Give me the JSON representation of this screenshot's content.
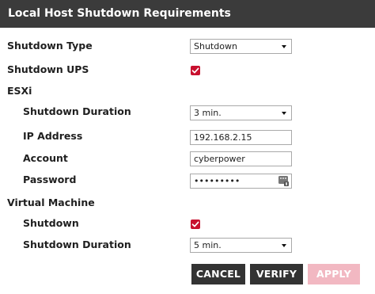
{
  "dialog": {
    "title": "Local Host Shutdown Requirements"
  },
  "shutdown_type": {
    "label": "Shutdown Type",
    "value": "Shutdown"
  },
  "shutdown_ups": {
    "label": "Shutdown UPS",
    "checked": true
  },
  "esxi": {
    "heading": "ESXi",
    "shutdown_duration": {
      "label": "Shutdown Duration",
      "value": "3 min."
    },
    "ip_address": {
      "label": "IP Address",
      "value": "192.168.2.15"
    },
    "account": {
      "label": "Account",
      "value": "cyberpower"
    },
    "password": {
      "label": "Password",
      "value": "•••••••••"
    }
  },
  "virtual_machine": {
    "heading": "Virtual Machine",
    "shutdown": {
      "label": "Shutdown",
      "checked": true
    },
    "shutdown_duration": {
      "label": "Shutdown Duration",
      "value": "5 min."
    }
  },
  "buttons": {
    "cancel": "CANCEL",
    "verify": "VERIFY",
    "apply": "APPLY"
  },
  "colors": {
    "titlebar": "#3b3b3b",
    "checkbox": "#c8102e",
    "button_dark": "#333333",
    "button_disabled": "#f2b8c2"
  },
  "icons": {
    "password_toggle": "keyboard-icon",
    "dropdown": "chevron-down-icon"
  }
}
